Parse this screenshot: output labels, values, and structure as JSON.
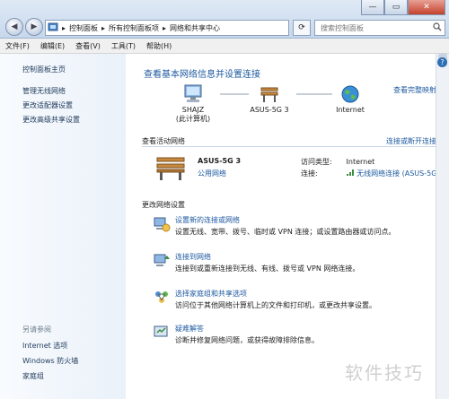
{
  "window": {
    "controls": {
      "minimize": "—",
      "maximize": "▭",
      "close": "✕"
    }
  },
  "address": {
    "segments": [
      "控制面板",
      "所有控制面板项",
      "网络和共享中心"
    ],
    "separator": "▸"
  },
  "search": {
    "placeholder": "搜索控制面板"
  },
  "menu": [
    "文件(F)",
    "编辑(E)",
    "查看(V)",
    "工具(T)",
    "帮助(H)"
  ],
  "sidebar": {
    "home": "控制面板主页",
    "links": [
      "管理无线网络",
      "更改适配器设置",
      "更改高级共享设置"
    ],
    "see_also_title": "另请参阅",
    "see_also": [
      "Internet 选项",
      "Windows 防火墙",
      "家庭组"
    ]
  },
  "main": {
    "title": "查看基本网络信息并设置连接",
    "full_map": "查看完整映射",
    "map": {
      "computer": "SHAJZ",
      "computer_sub": "(此计算机)",
      "network": "ASUS-5G  3",
      "internet": "Internet"
    },
    "active_title": "查看活动网络",
    "connect_disconnect": "连接或断开连接",
    "network_name": "ASUS-5G  3",
    "network_type": "公用网络",
    "access_type_label": "访问类型:",
    "access_type_value": "Internet",
    "connections_label": "连接:",
    "connections_value": "无线网络连接 (ASUS-5G)",
    "change_title": "更改网络设置",
    "tasks": [
      {
        "title": "设置新的连接或网络",
        "desc": "设置无线、宽带、拨号、临时或 VPN 连接；或设置路由器或访问点。"
      },
      {
        "title": "连接到网络",
        "desc": "连接到或重新连接到无线、有线、拨号或 VPN 网络连接。"
      },
      {
        "title": "选择家庭组和共享选项",
        "desc": "访问位于其他网络计算机上的文件和打印机，或更改共享设置。"
      },
      {
        "title": "疑难解答",
        "desc": "诊断并修复网络问题，或获得故障排除信息。"
      }
    ]
  },
  "watermark": "软件技巧",
  "colors": {
    "link": "#1e5aa0",
    "title_bar": "#c7d8ec"
  }
}
